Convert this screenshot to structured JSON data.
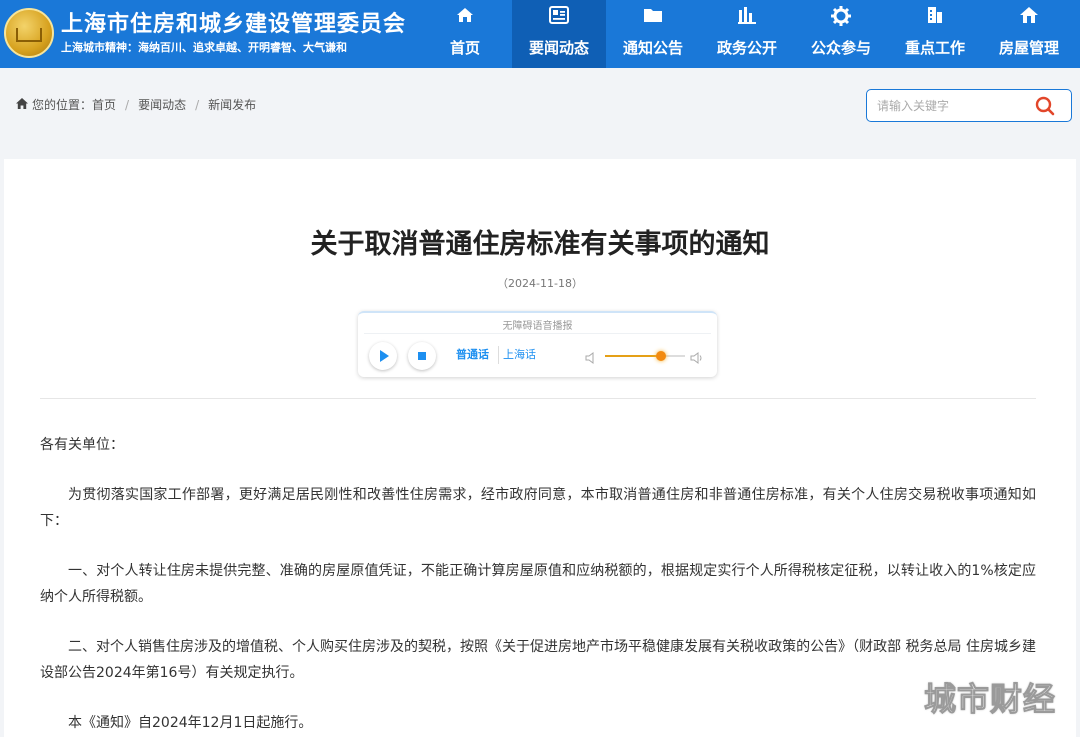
{
  "header": {
    "title": "上海市住房和城乡建设管理委员会",
    "motto": "上海城市精神：海纳百川、追求卓越、开明睿智、大气谦和",
    "nav": [
      {
        "label": "首页",
        "icon": "home-icon"
      },
      {
        "label": "要闻动态",
        "icon": "news-icon"
      },
      {
        "label": "通知公告",
        "icon": "folder-icon"
      },
      {
        "label": "政务公开",
        "icon": "bar-chart-icon"
      },
      {
        "label": "公众参与",
        "icon": "gear-icon"
      },
      {
        "label": "重点工作",
        "icon": "building-icon"
      },
      {
        "label": "房屋管理",
        "icon": "house-icon"
      }
    ],
    "active_nav": "要闻动态",
    "brand_color": "#1a78d8"
  },
  "breadcrumb": {
    "label": "您的位置：",
    "items": [
      "首页",
      "要闻动态",
      "新闻发布"
    ]
  },
  "search": {
    "placeholder": "请输入关键字",
    "value": ""
  },
  "article": {
    "title": "关于取消普通住房标准有关事项的通知",
    "date": "（2024-11-18）",
    "player": {
      "label": "无障碍语音播报",
      "languages": [
        "普通话",
        "上海话"
      ],
      "selected_language": "普通话",
      "volume": 0.7
    },
    "paragraphs": [
      "各有关单位：",
      "为贯彻落实国家工作部署，更好满足居民刚性和改善性住房需求，经市政府同意，本市取消普通住房和非普通住房标准，有关个人住房交易税收事项通知如下：",
      "一、对个人转让住房未提供完整、准确的房屋原值凭证，不能正确计算房屋原值和应纳税额的，根据规定实行个人所得税核定征税，以转让收入的1%核定应纳个人所得税额。",
      "二、对个人销售住房涉及的增值税、个人购买住房涉及的契税，按照《关于促进房地产市场平稳健康发展有关税收政策的公告》（财政部 税务总局 住房城乡建设部公告2024年第16号）有关规定执行。",
      "本《通知》自2024年12月1日起施行。"
    ]
  },
  "watermark": "城市财经"
}
